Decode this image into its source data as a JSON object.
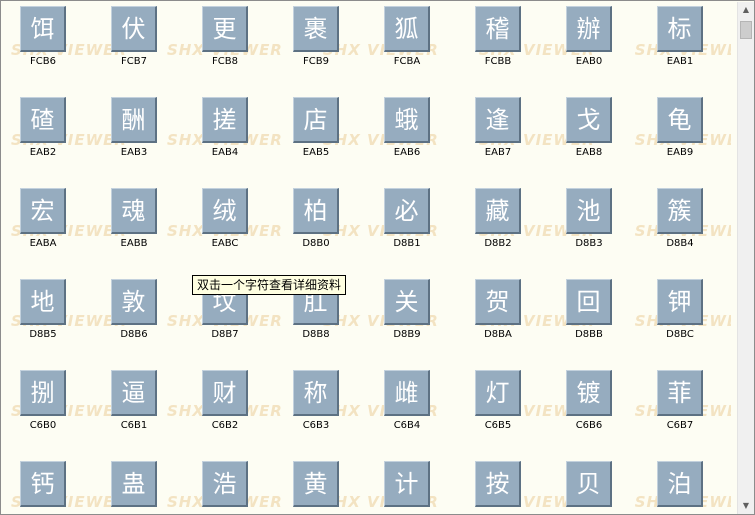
{
  "watermark": {
    "text": "SHX VIEWER"
  },
  "tooltip": {
    "text": "双击一个字符查看详细资料"
  },
  "scrollbar": {
    "up_icon": "▲",
    "down_icon": "▼",
    "up_icon_name": "arrow-up-icon",
    "down_icon_name": "arrow-down-icon"
  },
  "rows": [
    [
      {
        "char": "饵",
        "code": "FCB6"
      },
      {
        "char": "伏",
        "code": "FCB7"
      },
      {
        "char": "更",
        "code": "FCB8"
      },
      {
        "char": "裹",
        "code": "FCB9"
      },
      {
        "char": "狐",
        "code": "FCBA"
      },
      {
        "char": "稽",
        "code": "FCBB"
      },
      {
        "char": "辦",
        "code": "EAB0"
      },
      {
        "char": "标",
        "code": "EAB1"
      }
    ],
    [
      {
        "char": "碴",
        "code": "EAB2"
      },
      {
        "char": "酬",
        "code": "EAB3"
      },
      {
        "char": "搓",
        "code": "EAB4"
      },
      {
        "char": "店",
        "code": "EAB5"
      },
      {
        "char": "蛾",
        "code": "EAB6"
      },
      {
        "char": "逢",
        "code": "EAB7"
      },
      {
        "char": "戈",
        "code": "EAB8"
      },
      {
        "char": "龟",
        "code": "EAB9"
      }
    ],
    [
      {
        "char": "宏",
        "code": "EABA"
      },
      {
        "char": "魂",
        "code": "EABB"
      },
      {
        "char": "绒",
        "code": "EABC"
      },
      {
        "char": "柏",
        "code": "D8B0"
      },
      {
        "char": "必",
        "code": "D8B1"
      },
      {
        "char": "藏",
        "code": "D8B2"
      },
      {
        "char": "池",
        "code": "D8B3"
      },
      {
        "char": "簇",
        "code": "D8B4"
      }
    ],
    [
      {
        "char": "地",
        "code": "D8B5"
      },
      {
        "char": "敦",
        "code": "D8B6"
      },
      {
        "char": "坟",
        "code": "D8B7"
      },
      {
        "char": "肛",
        "code": "D8B8"
      },
      {
        "char": "关",
        "code": "D8B9"
      },
      {
        "char": "贺",
        "code": "D8BA"
      },
      {
        "char": "回",
        "code": "D8BB"
      },
      {
        "char": "钾",
        "code": "D8BC"
      }
    ],
    [
      {
        "char": "捌",
        "code": "C6B0"
      },
      {
        "char": "逼",
        "code": "C6B1"
      },
      {
        "char": "财",
        "code": "C6B2"
      },
      {
        "char": "称",
        "code": "C6B3"
      },
      {
        "char": "雌",
        "code": "C6B4"
      },
      {
        "char": "灯",
        "code": "C6B5"
      },
      {
        "char": "镀",
        "code": "C6B6"
      },
      {
        "char": "菲",
        "code": "C6B7"
      }
    ],
    [
      {
        "char": "钙",
        "code": ""
      },
      {
        "char": "蛊",
        "code": ""
      },
      {
        "char": "浩",
        "code": ""
      },
      {
        "char": "黄",
        "code": ""
      },
      {
        "char": "计",
        "code": ""
      },
      {
        "char": "按",
        "code": ""
      },
      {
        "char": "贝",
        "code": ""
      },
      {
        "char": "泊",
        "code": ""
      }
    ]
  ]
}
